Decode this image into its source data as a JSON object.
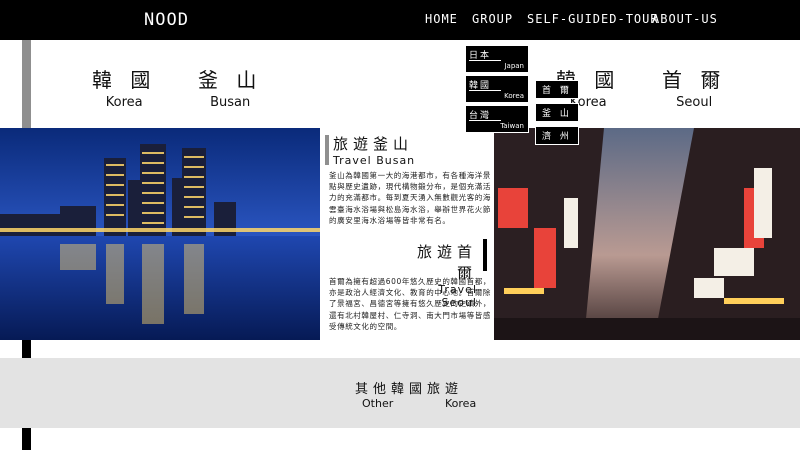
{
  "header": {
    "logo": "NOOD",
    "nav": [
      "HOME",
      "GROUP",
      "SELF-GUIDED-TOUR",
      "ABOUT-US"
    ]
  },
  "cities": [
    {
      "cn": "韓 國",
      "en": "Korea"
    },
    {
      "cn": "釜 山",
      "en": "Busan"
    },
    {
      "cn": "韓 國",
      "en": "Korea"
    },
    {
      "cn": "首 爾",
      "en": "Seoul"
    }
  ],
  "dropdown": {
    "countries": [
      {
        "cn": "日本",
        "en": "Japan"
      },
      {
        "cn": "韓國",
        "en": "Korea"
      },
      {
        "cn": "台灣",
        "en": "Taiwan"
      }
    ],
    "korea_cities": [
      "首 爾",
      "釜 山",
      "濟 州"
    ]
  },
  "busan": {
    "title_cn": "旅遊釜山",
    "title_en": "Travel  Busan",
    "text": "釜山為韓國第一大的海港都市，有各種海洋景點與歷史遺跡，現代構物鍛分布，是個充滿活力的充滿都市。每到夏天湧入無數觀光客的海雲臺海水浴場與松島海水浴，舉辦世界花火節的廣安里海水浴場等皆非常有名。"
  },
  "seoul": {
    "title_cn": "旅遊首爾",
    "title_en": "Travel  Seoul",
    "text": "首爾為擁有超過600年悠久歷史的韓國首都，亦是政治人經濟文化、教育的中心地。首爾除了景福宮、昌德宮等擁有悠久歷史的史蹟外，還有北村韓屋村、仁寺洞、南大門市場等皆感受傳統文化的空間。"
  },
  "footer": {
    "title_cn": "其他韓國旅遊",
    "en_left": "Other",
    "en_right": "Korea"
  }
}
